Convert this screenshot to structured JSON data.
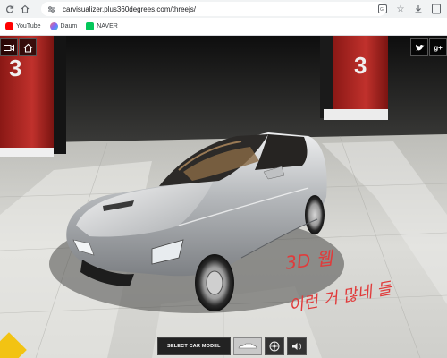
{
  "browser": {
    "url": "carvisualizer.plus360degrees.com/threejs/",
    "bookmarks": [
      {
        "label": "YouTube",
        "color": "#ff0000"
      },
      {
        "label": "Daum",
        "color": "#7b6cff"
      },
      {
        "label": "NAVER",
        "color": "#03c75a"
      }
    ]
  },
  "viewer": {
    "stall_numbers": [
      "3",
      "3"
    ],
    "select_label": "SELECT CAR MODEL",
    "social": {
      "twitter": "t",
      "gplus": "g+"
    }
  },
  "annotation": {
    "line1": "3D 웹",
    "line2": "이런 거 많네 들"
  },
  "colors": {
    "pillar_red": "#b5221f",
    "car_silver": "#c9cbcd",
    "floor": "#d8d8d4",
    "accent": "#e03b3b"
  }
}
